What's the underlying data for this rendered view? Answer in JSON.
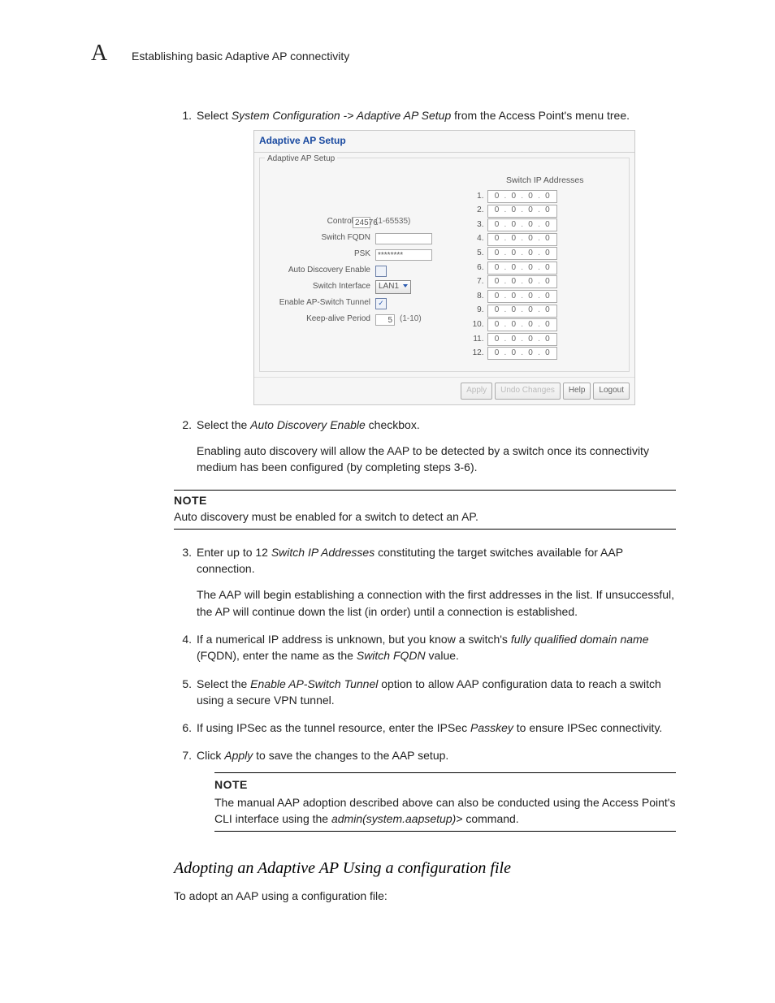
{
  "header": {
    "appendix_letter": "A",
    "running_title": "Establishing basic Adaptive AP connectivity"
  },
  "steps": [
    {
      "n": "1.",
      "pre": "Select ",
      "it1": "System Configuration -> Adaptive AP Setup",
      "post": " from the Access Point's menu tree."
    },
    {
      "n": "2.",
      "pre": "Select the ",
      "it1": "Auto Discovery Enable",
      "post": " checkbox.",
      "para": "Enabling auto discovery will allow the AAP to be detected by a switch once its connectivity medium has been configured (by completing steps 3-6)."
    },
    {
      "n": "3.",
      "pre": "Enter up to 12 ",
      "it1": "Switch IP Addresses",
      "post": " constituting the target switches available for AAP connection.",
      "para": "The AAP will begin establishing a connection with the first addresses in the list. If unsuccessful, the AP will continue down the list (in order) until a connection is established."
    },
    {
      "n": "4.",
      "pre": "If a numerical IP address is unknown, but you know a switch's ",
      "it1": "fully qualified domain name",
      "post": " (FQDN), enter the name as the ",
      "it2": "Switch FQDN",
      "post2": " value."
    },
    {
      "n": "5.",
      "pre": "Select the ",
      "it1": "Enable AP-Switch Tunnel",
      "post": " option to allow AAP configuration data to reach a switch using a secure VPN tunnel."
    },
    {
      "n": "6.",
      "pre": "If using IPSec as the tunnel resource, enter the IPSec ",
      "it1": "Passkey",
      "post": " to ensure IPSec connectivity."
    },
    {
      "n": "7.",
      "pre": "Click ",
      "it1": "Apply",
      "post": " to save the changes to the AAP setup."
    }
  ],
  "note1": {
    "label": "NOTE",
    "text": "Auto discovery must be enabled for a switch to detect an AP."
  },
  "note2": {
    "label": "NOTE",
    "text_pre": "The manual AAP adoption described above can also be conducted using the Access Point's CLI interface using the ",
    "cmd": "admin(system.aapsetup)>",
    "text_post": " command."
  },
  "subheading": "Adopting an Adaptive AP Using a configuration file",
  "sub_para": "To adopt an AAP using a configuration file:",
  "figure": {
    "title": "Adaptive AP Setup",
    "legend": "Adaptive AP Setup",
    "labels": {
      "control_port": "Control Port",
      "switch_fqdn": "Switch FQDN",
      "psk": "PSK",
      "auto_discovery": "Auto Discovery Enable",
      "switch_interface": "Switch Interface",
      "enable_tunnel": "Enable AP-Switch Tunnel",
      "keep_alive": "Keep-alive Period"
    },
    "values": {
      "control_port": "24576",
      "control_port_hint": "(1-65535)",
      "switch_fqdn": "",
      "psk": "********",
      "switch_interface": "LAN1",
      "keep_alive": "5",
      "keep_alive_hint": "(1-10)",
      "auto_discovery_checked": false,
      "enable_tunnel_checked": true
    },
    "ip_title": "Switch IP Addresses",
    "ip_rows": [
      {
        "n": "1.",
        "o": [
          "0",
          "0",
          "0",
          "0"
        ]
      },
      {
        "n": "2.",
        "o": [
          "0",
          "0",
          "0",
          "0"
        ]
      },
      {
        "n": "3.",
        "o": [
          "0",
          "0",
          "0",
          "0"
        ]
      },
      {
        "n": "4.",
        "o": [
          "0",
          "0",
          "0",
          "0"
        ]
      },
      {
        "n": "5.",
        "o": [
          "0",
          "0",
          "0",
          "0"
        ]
      },
      {
        "n": "6.",
        "o": [
          "0",
          "0",
          "0",
          "0"
        ]
      },
      {
        "n": "7.",
        "o": [
          "0",
          "0",
          "0",
          "0"
        ]
      },
      {
        "n": "8.",
        "o": [
          "0",
          "0",
          "0",
          "0"
        ]
      },
      {
        "n": "9.",
        "o": [
          "0",
          "0",
          "0",
          "0"
        ]
      },
      {
        "n": "10.",
        "o": [
          "0",
          "0",
          "0",
          "0"
        ]
      },
      {
        "n": "11.",
        "o": [
          "0",
          "0",
          "0",
          "0"
        ]
      },
      {
        "n": "12.",
        "o": [
          "0",
          "0",
          "0",
          "0"
        ]
      }
    ],
    "buttons": {
      "apply": "Apply",
      "undo": "Undo Changes",
      "help": "Help",
      "logout": "Logout"
    }
  }
}
